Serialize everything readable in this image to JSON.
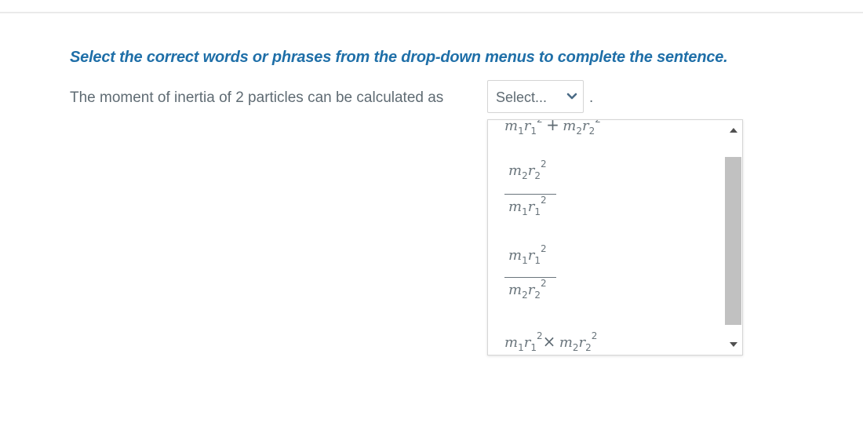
{
  "instruction": "Select the correct words or phrases from the drop-down menus to complete the sentence.",
  "sentence": {
    "prefix": "The moment of inertia of 2 particles can be calculated as",
    "suffix": "."
  },
  "select": {
    "placeholder": "Select...",
    "chevron_icon": "chevron-down-icon"
  },
  "options": [
    {
      "kind": "sum",
      "text": "m1r1^2 + m2r2^2",
      "a": "m",
      "a_sub": "1",
      "b": "r",
      "b_sub": "1",
      "exp": "2",
      "op": "+",
      "c": "m",
      "c_sub": "2",
      "d": "r",
      "d_sub": "2",
      "exp2": "2"
    },
    {
      "kind": "fraction",
      "text": "m2r2^2 / m1r1^2",
      "num_m": "m",
      "num_m_sub": "2",
      "num_r": "r",
      "num_r_sub": "2",
      "num_exp": "2",
      "den_m": "m",
      "den_m_sub": "1",
      "den_r": "r",
      "den_r_sub": "1",
      "den_exp": "2"
    },
    {
      "kind": "fraction",
      "text": "m1r1^2 / m2r2^2",
      "num_m": "m",
      "num_m_sub": "1",
      "num_r": "r",
      "num_r_sub": "1",
      "num_exp": "2",
      "den_m": "m",
      "den_m_sub": "2",
      "den_r": "r",
      "den_r_sub": "2",
      "den_exp": "2"
    },
    {
      "kind": "product",
      "text": "m1r1^2 × m2r2^2",
      "a": "m",
      "a_sub": "1",
      "b": "r",
      "b_sub": "1",
      "exp": "2",
      "op": "×",
      "c": "m",
      "c_sub": "2",
      "d": "r",
      "d_sub": "2",
      "exp2": "2"
    }
  ],
  "scrollbar": {
    "up_icon": "scroll-up-arrow-icon",
    "down_icon": "scroll-down-arrow-icon"
  },
  "colors": {
    "instruction": "#1f6fa8",
    "text": "#5f6b73",
    "border": "#d4d4d4",
    "scroll_thumb": "#c1c1c1"
  }
}
